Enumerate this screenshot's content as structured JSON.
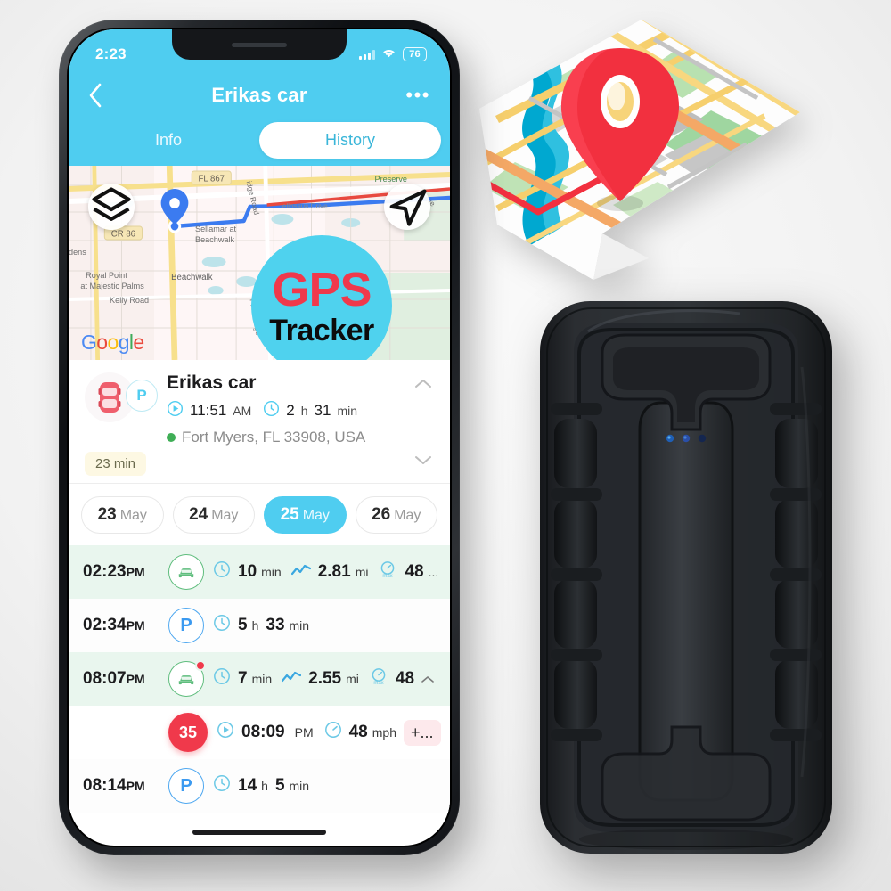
{
  "status_bar": {
    "time": "2:23",
    "battery": "76",
    "signal_icon": "signal-bars-icon",
    "wifi_icon": "wifi-icon"
  },
  "header": {
    "back_icon": "chevron-left-icon",
    "title": "Erikas car",
    "more_icon": "more-horizontal-icon",
    "tabs": [
      {
        "label": "Info",
        "active": false
      },
      {
        "label": "History",
        "active": true
      }
    ]
  },
  "map": {
    "layers_icon": "layers-icon",
    "navigate_icon": "navigation-arrow-icon",
    "attribution": "Google",
    "labels": [
      "FL 867",
      "CR 86",
      "Sellamar at",
      "Beachwalk",
      "Preserve",
      "Drive",
      "Ridge Road",
      "Royal Point",
      "at Majestic Palms",
      "Kelly Road",
      "Beachwalk",
      "dens",
      "Pine Ridge"
    ],
    "badge": {
      "line1": "GPS",
      "line2": "Tracker",
      "bg": "#4fd2ee",
      "line1_color": "#f0394b",
      "line2_color": "#0c0c0c"
    }
  },
  "summary": {
    "vehicle_icon": "car-top-view-icon",
    "status_badge": "P",
    "name": "Erikas car",
    "start_icon": "play-circle-icon",
    "start_time": "11:51",
    "start_ampm": "AM",
    "duration_icon": "clock-icon",
    "duration_value": "2",
    "duration_unit_h": "h",
    "duration_minutes": "31",
    "duration_unit_min": "min",
    "address": "Fort Myers, FL 33908, USA",
    "idle_pill": "23 min",
    "collapse_icon": "chevron-up-icon",
    "expand_icon": "chevron-down-icon"
  },
  "dates": [
    {
      "day": "23",
      "month": "May",
      "selected": false
    },
    {
      "day": "24",
      "month": "May",
      "selected": false
    },
    {
      "day": "25",
      "month": "May",
      "selected": true
    },
    {
      "day": "26",
      "month": "May",
      "selected": false
    }
  ],
  "trips": [
    {
      "type": "drive",
      "time": "02:23",
      "ampm": "PM",
      "marker_icon": "car-icon",
      "alert": false,
      "stats": [
        {
          "icon": "clock-icon",
          "num": "10",
          "unit": "min"
        },
        {
          "icon": "route-chart-icon",
          "num": "2.81",
          "unit": "mi"
        },
        {
          "icon": "speed-max-icon",
          "num": "48",
          "unit": "..."
        }
      ]
    },
    {
      "type": "park",
      "time": "02:34",
      "ampm": "PM",
      "marker_icon": "parking-icon",
      "alert": false,
      "stats": [
        {
          "icon": "clock-icon",
          "num": "5",
          "unit": "h"
        },
        {
          "icon": "",
          "num": "33",
          "unit": "min"
        }
      ]
    },
    {
      "type": "drive",
      "time": "08:07",
      "ampm": "PM",
      "marker_icon": "car-icon",
      "alert": true,
      "stats": [
        {
          "icon": "clock-icon",
          "num": "7",
          "unit": "min"
        },
        {
          "icon": "route-chart-icon",
          "num": "2.55",
          "unit": "mi"
        },
        {
          "icon": "speed-max-icon",
          "num": "48",
          "unit": ""
        }
      ]
    },
    {
      "type": "speedalert",
      "time": "",
      "ampm": "",
      "marker_icon": "speed-badge-icon",
      "marker_value": "35",
      "alert": false,
      "stats": [
        {
          "icon": "play-circle-icon",
          "num": "08:09",
          "unit": "PM"
        },
        {
          "icon": "speedometer-icon",
          "num": "48",
          "unit": "mph"
        }
      ],
      "extra_pill": "+..."
    },
    {
      "type": "park",
      "time": "08:14",
      "ampm": "PM",
      "marker_icon": "parking-icon",
      "alert": false,
      "stats": [
        {
          "icon": "clock-icon",
          "num": "14",
          "unit": "h"
        },
        {
          "icon": "",
          "num": "5",
          "unit": "min"
        }
      ]
    }
  ],
  "product": {
    "paper_map_icon": "folded-map-illustration",
    "map_pin_icon": "location-pin-icon",
    "device_icon": "gps-tracker-device",
    "device_leds": 3
  },
  "colors": {
    "brand_cyan": "#4fcdf0",
    "badge_cyan": "#4fd2ee",
    "alert_red": "#f0394b",
    "drive_green": "#5fbd7d",
    "drive_row_bg": "#e9f6ee",
    "park_blue": "#4fa8f0"
  }
}
